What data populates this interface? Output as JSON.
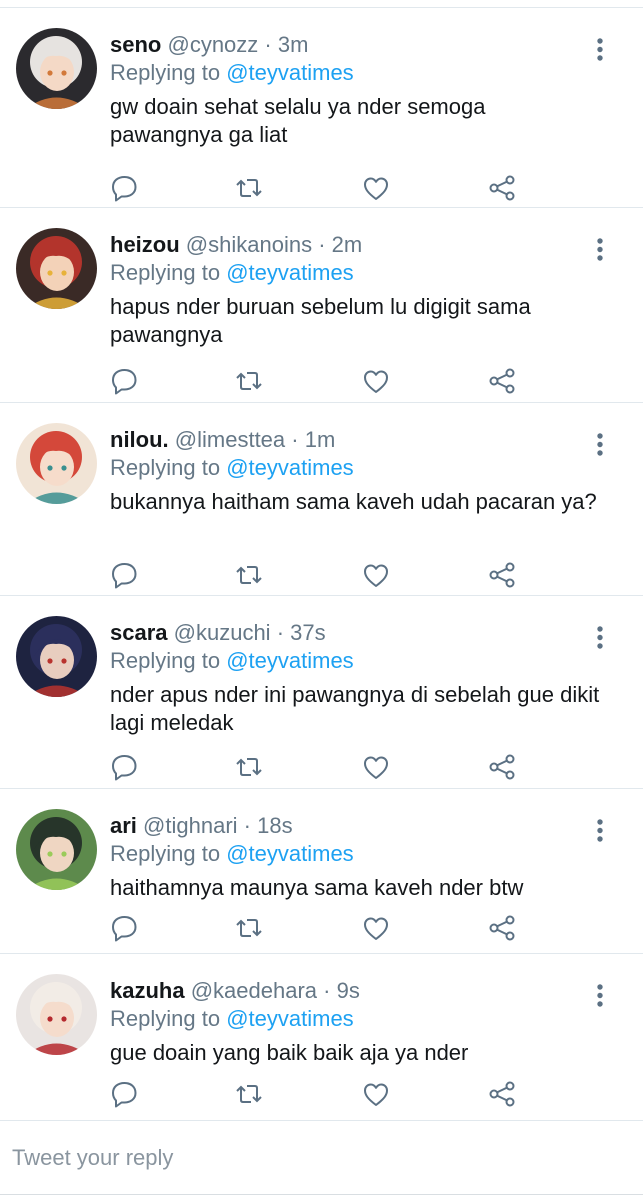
{
  "replies": [
    {
      "name": "seno",
      "handle": "@cynozz",
      "time": "3m",
      "replying_prefix": "Replying to",
      "replying_to": "@teyvatimes",
      "text": "gw doain sehat selalu ya nder semoga pawangnya ga liat",
      "avatar": {
        "bg": "#2b2a2e",
        "hair": "#e6e3e0",
        "skin": "#f4d9c6",
        "accent": "#d2793a"
      }
    },
    {
      "name": "heizou",
      "handle": "@shikanoins",
      "time": "2m",
      "replying_prefix": "Replying to",
      "replying_to": "@teyvatimes",
      "text": "hapus nder buruan sebelum lu digigit sama pawangnya",
      "avatar": {
        "bg": "#3a2a26",
        "hair": "#b3342c",
        "skin": "#f3d2b8",
        "accent": "#e7b23a"
      }
    },
    {
      "name": "nilou.",
      "handle": "@limesttea",
      "time": "1m",
      "replying_prefix": "Replying to",
      "replying_to": "@teyvatimes",
      "text": "bukannya haitham sama kaveh udah pacaran ya?",
      "avatar": {
        "bg": "#f1e4d6",
        "hair": "#d4483a",
        "skin": "#f6dccb",
        "accent": "#3a8f8f"
      }
    },
    {
      "name": "scara",
      "handle": "@kuzuchi",
      "time": "37s",
      "replying_prefix": "Replying to",
      "replying_to": "@teyvatimes",
      "text": "nder apus nder ini pawangnya di sebelah gue dikit lagi meledak",
      "avatar": {
        "bg": "#1e2340",
        "hair": "#2b2f5c",
        "skin": "#e8cdbf",
        "accent": "#b8332e"
      }
    },
    {
      "name": "ari",
      "handle": "@tighnari",
      "time": "18s",
      "replying_prefix": "Replying to",
      "replying_to": "@teyvatimes",
      "text": "haithamnya maunya sama kaveh nder btw",
      "avatar": {
        "bg": "#5d8a4c",
        "hair": "#27352a",
        "skin": "#efd6c2",
        "accent": "#9acb5a"
      }
    },
    {
      "name": "kazuha",
      "handle": "@kaedehara",
      "time": "9s",
      "replying_prefix": "Replying to",
      "replying_to": "@teyvatimes",
      "text": "gue doain yang baik baik aja ya nder",
      "avatar": {
        "bg": "#e9e4e2",
        "hair": "#f2ece6",
        "skin": "#f5dccc",
        "accent": "#b5292e"
      }
    }
  ],
  "compose": {
    "placeholder": "Tweet your reply"
  },
  "colors": {
    "link": "#1da1f2",
    "meta": "#657786",
    "icon": "#5b7083",
    "divider": "#e1e8ed"
  }
}
